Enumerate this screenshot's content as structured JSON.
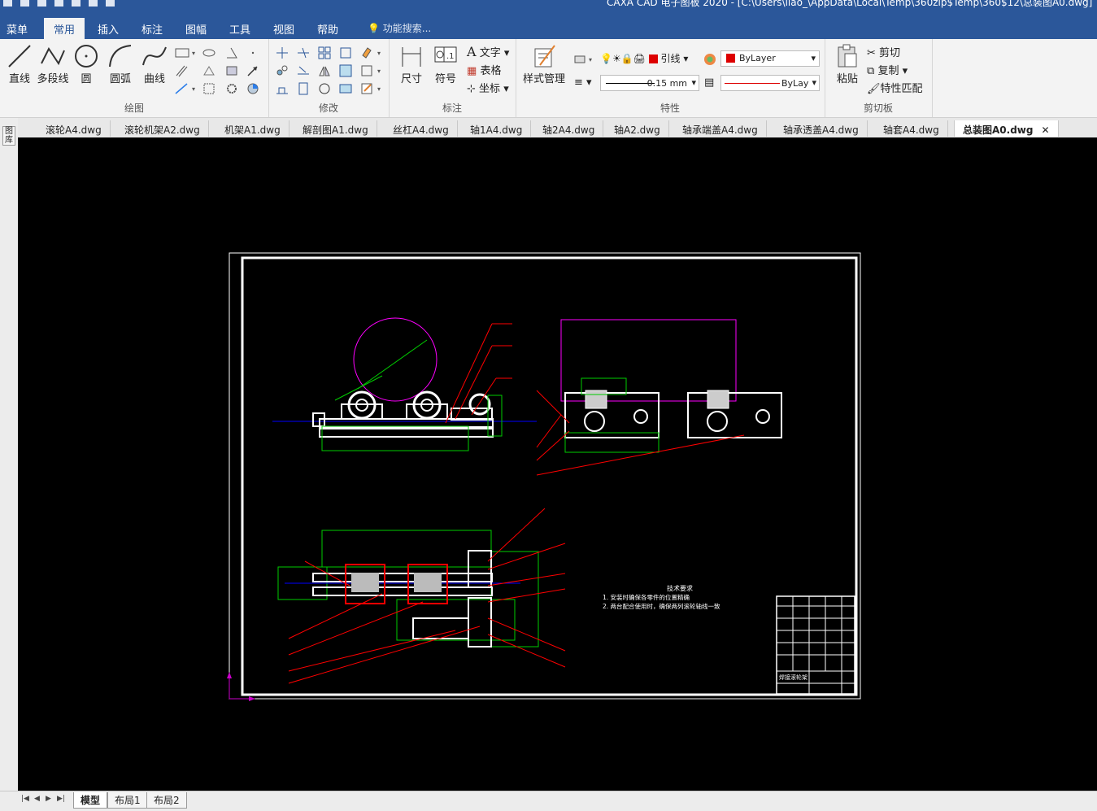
{
  "window": {
    "title": "CAXA CAD 电子图板 2020 - [C:\\Users\\liao_\\AppData\\Local\\Temp\\360zip$Temp\\360$12\\总装图A0.dwg]"
  },
  "menu": {
    "tabs": [
      {
        "label": "菜单"
      },
      {
        "label": "常用"
      },
      {
        "label": "插入"
      },
      {
        "label": "标注"
      },
      {
        "label": "图幅"
      },
      {
        "label": "工具"
      },
      {
        "label": "视图"
      },
      {
        "label": "帮助"
      }
    ],
    "search_placeholder": "功能搜索..."
  },
  "ribbon": {
    "draw": {
      "group": "绘图",
      "line": "直线",
      "polyline": "多段线",
      "circle": "圆",
      "arc": "圆弧",
      "curve": "曲线"
    },
    "modify": {
      "group": "修改"
    },
    "annotate": {
      "group": "标注",
      "dimension": "尺寸",
      "symbol": "符号",
      "text": "文字",
      "table": "表格",
      "coord": "坐标"
    },
    "properties": {
      "group": "特性",
      "style_manager": "样式管理",
      "layer_text": "引线",
      "color_value": "ByLayer",
      "linewidth": "0.15 mm",
      "linetype": "ByLayer"
    },
    "clipboard": {
      "group": "剪切板",
      "paste": "粘贴",
      "cut": "剪切",
      "copy": "复制",
      "match": "特性匹配"
    }
  },
  "doc_tabs": [
    {
      "label": "滚轮A4.dwg"
    },
    {
      "label": "滚轮机架A2.dwg"
    },
    {
      "label": "机架A1.dwg"
    },
    {
      "label": "解剖图A1.dwg"
    },
    {
      "label": "丝杠A4.dwg"
    },
    {
      "label": "轴1A4.dwg"
    },
    {
      "label": "轴2A4.dwg"
    },
    {
      "label": "轴A2.dwg"
    },
    {
      "label": "轴承端盖A4.dwg"
    },
    {
      "label": "轴承透盖A4.dwg"
    },
    {
      "label": "轴套A4.dwg"
    },
    {
      "label": "总装图A0.dwg"
    }
  ],
  "left_strip": {
    "label": "图库"
  },
  "drawing": {
    "tech_title": "技术要求",
    "tech_line1": "1. 安装时确保各零件的位置精确",
    "tech_line2": "2. 两台配合使用时，确保两列滚轮轴线一致",
    "titleblock_name": "焊接滚轮架"
  },
  "layout_tabs": [
    {
      "label": "模型"
    },
    {
      "label": "布局1"
    },
    {
      "label": "布局2"
    }
  ],
  "colors": {
    "accent": "#2b579a",
    "canvas": "#000000",
    "red": "#ff0000",
    "green": "#00c800",
    "magenta": "#ff00ff",
    "blue": "#0000ff"
  },
  "icons": [
    "line-icon",
    "polyline-icon",
    "circle-icon",
    "arc-icon",
    "curve-icon",
    "dimension-icon",
    "symbol-icon",
    "text-icon",
    "table-icon",
    "coord-icon",
    "style-icon",
    "paste-icon",
    "cut-icon",
    "copy-icon",
    "match-icon",
    "search-icon"
  ]
}
